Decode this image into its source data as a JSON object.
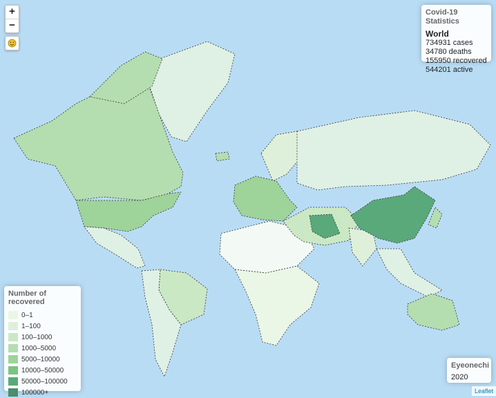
{
  "stats": {
    "title": "Covid-19 Statistics",
    "region": "World",
    "lines": [
      "734931 cases",
      "34780 deaths",
      "155950 recovered",
      "544201 active"
    ]
  },
  "legend": {
    "title": "Number of recovered",
    "items": [
      {
        "label": "0–1",
        "color": "#eaf6e6"
      },
      {
        "label": "1–100",
        "color": "#dff0da"
      },
      {
        "label": "100–1000",
        "color": "#cbe8c5"
      },
      {
        "label": "1000–5000",
        "color": "#b4ddb0"
      },
      {
        "label": "5000–10000",
        "color": "#9ed39a"
      },
      {
        "label": "10000–50000",
        "color": "#7cc47f"
      },
      {
        "label": "50000–100000",
        "color": "#5aa97a"
      },
      {
        "label": "100000+",
        "color": "#4a8e6c"
      }
    ]
  },
  "credit": {
    "title": "Eyeonechi",
    "year": "2020"
  },
  "controls": {
    "zoom_in": "+",
    "zoom_out": "−",
    "locate_icon": "smiley-icon"
  },
  "attribution": "Leaflet",
  "map_colors": {
    "ocean": "#b9dcf5",
    "land_default": "#dff0e4",
    "border": "#333333"
  }
}
